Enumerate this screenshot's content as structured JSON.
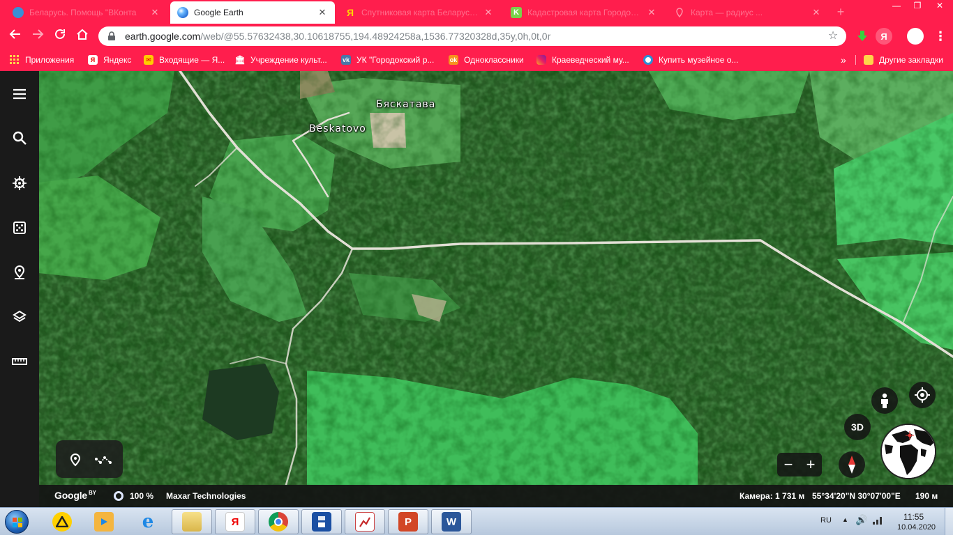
{
  "browser": {
    "tabs": [
      {
        "title": "Беларусь. Помощь \"ВКонта",
        "favicon": "vk-blue-icon",
        "active": false
      },
      {
        "title": "Google Earth",
        "favicon": "google-earth-icon",
        "active": true
      },
      {
        "title": "Спутниковая карта Беларуси он...",
        "favicon": "yandex-icon",
        "active": false
      },
      {
        "title": "Кадастровая карта Городокс...",
        "favicon": "k-green-icon",
        "active": false
      },
      {
        "title": "Карта — радиус ...",
        "favicon": "map-pin-icon",
        "active": false
      }
    ],
    "new_tab": "+",
    "window": {
      "minimize": "—",
      "restore": "❐",
      "close": "✕"
    },
    "url_host": "earth.google.com",
    "url_path": "/web/@55.57632438,30.10618755,194.48924258a,1536.77320328d,35y,0h,0t,0r",
    "bookmarks": [
      {
        "label": "Приложения",
        "icon": "apps-grid-icon"
      },
      {
        "label": "Яндекс",
        "icon": "yandex-icon"
      },
      {
        "label": "Входящие — Я...",
        "icon": "mail-icon"
      },
      {
        "label": "Учреждение культ...",
        "icon": "museum-icon"
      },
      {
        "label": "УК \"Городокский р...",
        "icon": "vk-icon"
      },
      {
        "label": "Одноклассники",
        "icon": "ok-icon"
      },
      {
        "label": "Краеведческий му...",
        "icon": "instagram-icon"
      },
      {
        "label": "Купить музейное о...",
        "icon": "globe-icon"
      }
    ],
    "bookmarks_more": "»",
    "other_bookmarks": "Другие закладки"
  },
  "earth": {
    "labels": [
      {
        "text": "Бяскатава"
      },
      {
        "text": "Beskatovo"
      }
    ],
    "btn_3d": "3D",
    "zoom_out": "−",
    "zoom_in": "+",
    "status": {
      "logo": "Google",
      "logo_sup": "BY",
      "zoom": "100 %",
      "attribution": "Maxar Technologies",
      "camera": "Камера: 1 731 м",
      "coords": "55°34'20\"N 30°07'00\"E",
      "elevation": "190 м"
    }
  },
  "taskbar": {
    "lang": "RU",
    "time": "11:55",
    "date": "10.04.2020"
  }
}
